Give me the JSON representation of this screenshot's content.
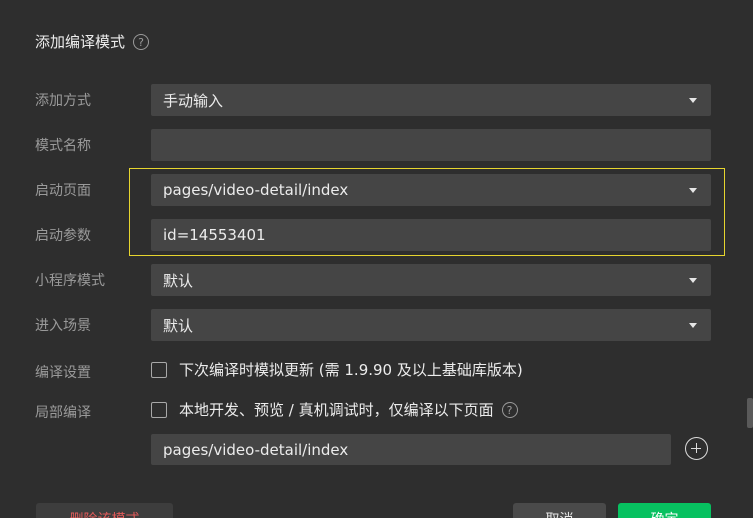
{
  "dialog": {
    "title": "添加编译模式",
    "title_help": "?"
  },
  "form": {
    "add_method": {
      "label": "添加方式",
      "value": "手动输入"
    },
    "mode_name": {
      "label": "模式名称",
      "value": ""
    },
    "launch_page": {
      "label": "启动页面",
      "value": "pages/video-detail/index"
    },
    "launch_params": {
      "label": "启动参数",
      "value": "id=14553401"
    },
    "mini_program_mode": {
      "label": "小程序模式",
      "value": "默认"
    },
    "entry_scene": {
      "label": "进入场景",
      "value": "默认"
    },
    "compile_settings": {
      "label": "编译设置",
      "checkbox_text": "下次编译时模拟更新 (需 1.9.90 及以上基础库版本)",
      "checked": false
    },
    "partial_compile": {
      "label": "局部编译",
      "checkbox_text": "本地开发、预览 / 真机调试时，仅编译以下页面",
      "help": "?",
      "checked": false,
      "page_value": "pages/video-detail/index"
    }
  },
  "buttons": {
    "delete": "删除该模式",
    "cancel": "取消",
    "confirm": "确定"
  },
  "colors": {
    "background": "#2e2e2e",
    "field": "#454545",
    "highlight": "#e6d52e",
    "confirm": "#07c160",
    "danger": "#e05a5a"
  }
}
